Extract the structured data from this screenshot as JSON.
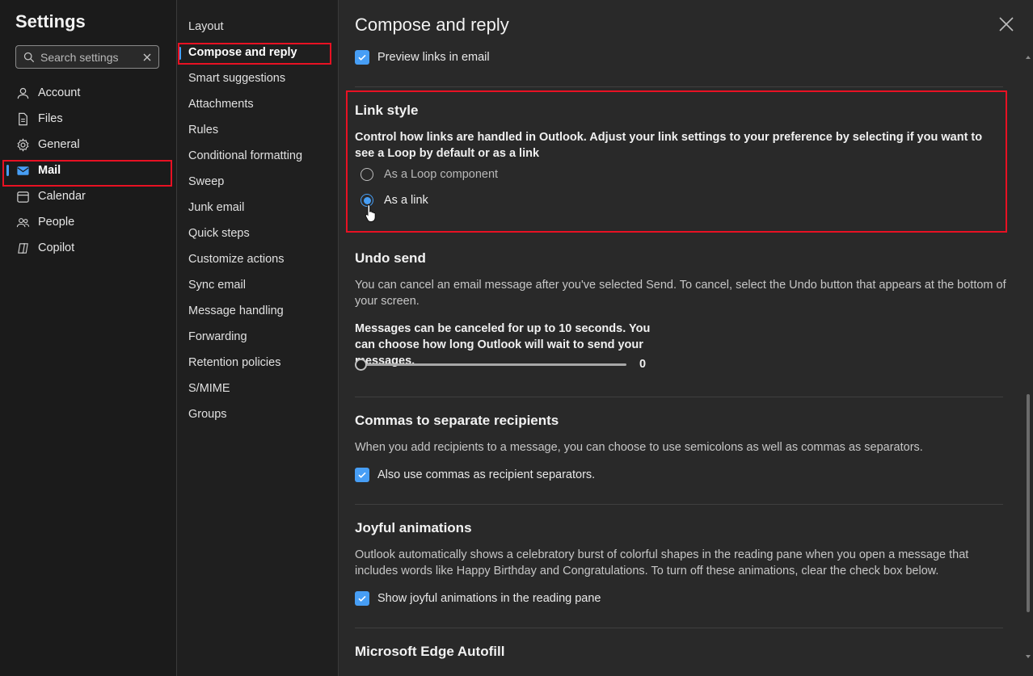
{
  "left": {
    "title": "Settings",
    "search_placeholder": "Search settings",
    "items": [
      {
        "label": "Account",
        "icon": "person-icon"
      },
      {
        "label": "Files",
        "icon": "file-icon"
      },
      {
        "label": "General",
        "icon": "gear-icon"
      },
      {
        "label": "Mail",
        "icon": "mail-icon"
      },
      {
        "label": "Calendar",
        "icon": "calendar-icon"
      },
      {
        "label": "People",
        "icon": "people-icon"
      },
      {
        "label": "Copilot",
        "icon": "copilot-icon"
      }
    ],
    "selected": "Mail"
  },
  "mid": {
    "items": [
      {
        "label": "Layout"
      },
      {
        "label": "Compose and reply"
      },
      {
        "label": "Smart suggestions"
      },
      {
        "label": "Attachments"
      },
      {
        "label": "Rules"
      },
      {
        "label": "Conditional formatting"
      },
      {
        "label": "Sweep"
      },
      {
        "label": "Junk email"
      },
      {
        "label": "Quick steps"
      },
      {
        "label": "Customize actions"
      },
      {
        "label": "Sync email"
      },
      {
        "label": "Message handling"
      },
      {
        "label": "Forwarding"
      },
      {
        "label": "Retention policies"
      },
      {
        "label": "S/MIME"
      },
      {
        "label": "Groups"
      }
    ],
    "selected": "Compose and reply"
  },
  "main": {
    "title": "Compose and reply",
    "preview_links_label": "Preview links in email",
    "link_style": {
      "title": "Link style",
      "desc": "Control how links are handled in Outlook. Adjust your link settings to your preference by selecting if you want to see a Loop by default or as a link",
      "option_loop": "As a Loop component",
      "option_link": "As a link",
      "selected": "As a link"
    },
    "undo_send": {
      "title": "Undo send",
      "desc": "You can cancel an email message after you've selected Send. To cancel, select the Undo button that appears at the bottom of your screen.",
      "slider_label": "Messages can be canceled for up to 10 seconds. You can choose how long Outlook will wait to send your messages.",
      "slider_value": "0"
    },
    "commas": {
      "title": "Commas to separate recipients",
      "desc": "When you add recipients to a message, you can choose to use semicolons as well as commas as separators.",
      "check_label": "Also use commas as recipient separators."
    },
    "joyful": {
      "title": "Joyful animations",
      "desc": "Outlook automatically shows a celebratory burst of colorful shapes in the reading pane when you open a message that includes words like Happy Birthday and Congratulations. To turn off these animations, clear the check box below.",
      "check_label": "Show joyful animations in the reading pane"
    },
    "edge": {
      "title": "Microsoft Edge Autofill"
    }
  },
  "colors": {
    "accent": "#479ef5",
    "highlight": "#e81123",
    "background": "#292929"
  }
}
